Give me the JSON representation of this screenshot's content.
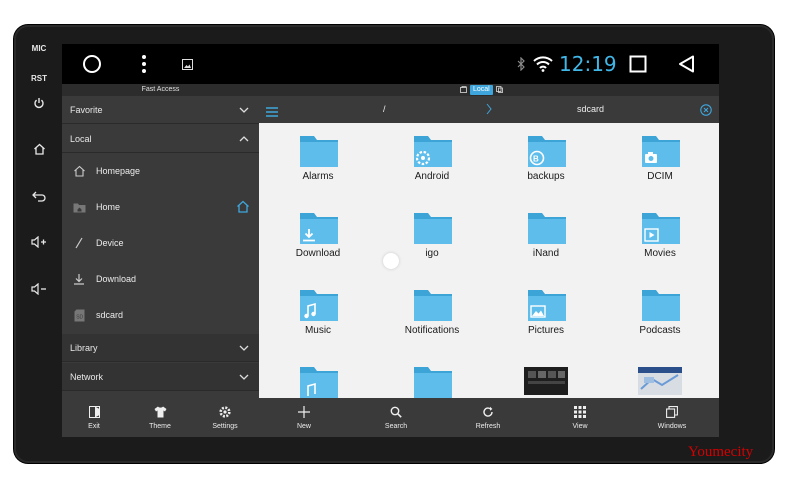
{
  "device": {
    "side_buttons": [
      {
        "label": "MIC",
        "icon": ""
      },
      {
        "label": "RST",
        "icon": ""
      },
      {
        "label": "",
        "icon": "power-icon"
      },
      {
        "label": "",
        "icon": "home-icon"
      },
      {
        "label": "",
        "icon": "back-icon"
      },
      {
        "label": "",
        "icon": "volume-up-icon"
      },
      {
        "label": "",
        "icon": "volume-down-icon"
      }
    ]
  },
  "statusbar": {
    "clock": "12:19",
    "icons": [
      "circle-home-icon",
      "dots-menu-icon",
      "gallery-icon",
      "bluetooth-icon",
      "wifi-icon",
      "recents-square-icon",
      "back-triangle-icon"
    ],
    "accent": "#41b7e8"
  },
  "subbar": {
    "fast_access": "Fast Access",
    "local_tab": "Local"
  },
  "sidebar": {
    "favorite": "Favorite",
    "local": "Local",
    "items": [
      {
        "label": "Homepage",
        "icon": "homepage-icon"
      },
      {
        "label": "Home",
        "icon": "home-folder-icon"
      },
      {
        "label": "Device",
        "icon": "slash-icon"
      },
      {
        "label": "Download",
        "icon": "download-icon"
      },
      {
        "label": "sdcard",
        "icon": "sd-card-icon"
      }
    ],
    "library": "Library",
    "network": "Network"
  },
  "pathbar": {
    "root": "/",
    "current": "sdcard"
  },
  "folders": [
    {
      "name": "Alarms",
      "badge": ""
    },
    {
      "name": "Android",
      "badge": "gear"
    },
    {
      "name": "backups",
      "badge": "backup"
    },
    {
      "name": "DCIM",
      "badge": "camera"
    },
    {
      "name": "Download",
      "badge": "download"
    },
    {
      "name": "igo",
      "badge": ""
    },
    {
      "name": "iNand",
      "badge": ""
    },
    {
      "name": "Movies",
      "badge": "play"
    },
    {
      "name": "Music",
      "badge": "music"
    },
    {
      "name": "Notifications",
      "badge": ""
    },
    {
      "name": "Pictures",
      "badge": "picture"
    },
    {
      "name": "Podcasts",
      "badge": ""
    }
  ],
  "toolbar_left": [
    {
      "label": "Exit",
      "icon": "exit-icon"
    },
    {
      "label": "Theme",
      "icon": "theme-shirt-icon"
    },
    {
      "label": "Settings",
      "icon": "settings-gear-icon"
    }
  ],
  "toolbar_right": [
    {
      "label": "New",
      "icon": "plus-icon"
    },
    {
      "label": "Search",
      "icon": "search-icon"
    },
    {
      "label": "Refresh",
      "icon": "refresh-icon"
    },
    {
      "label": "View",
      "icon": "grid-view-icon"
    },
    {
      "label": "Windows",
      "icon": "windows-icon"
    }
  ],
  "watermark": "Youmecity",
  "colors": {
    "folder": "#5ebdeb",
    "folder_dark": "#3da4d8",
    "panel": "#3a3a3a",
    "grid_bg": "#f2f2f2"
  }
}
